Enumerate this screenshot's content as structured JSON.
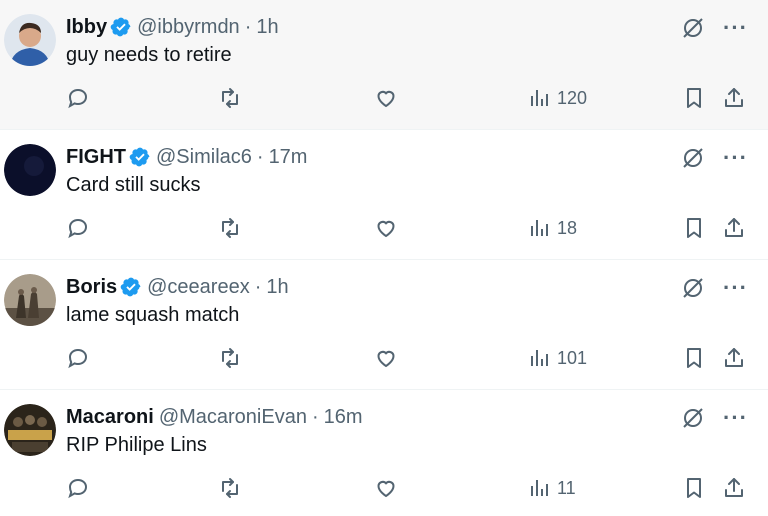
{
  "tweets": [
    {
      "name": "Ibby",
      "handle": "@ibbyrmdn",
      "time": "1h",
      "text": "guy needs to retire",
      "views": "120",
      "avatar_color": "#2f5fa8"
    },
    {
      "name": "FIGHT",
      "handle": "@Similac6",
      "time": "17m",
      "text": "Card still sucks",
      "views": "18",
      "avatar_color": "#0b0f2a"
    },
    {
      "name": "Boris",
      "handle": "@ceeareex",
      "time": "1h",
      "text": "lame squash match",
      "views": "101",
      "avatar_color": "#7a6a58"
    },
    {
      "name": "Macaroni",
      "handle": "@MacaroniEvan",
      "time": "16m",
      "text": "RIP Philipe Lins",
      "views": "11",
      "avatar_color": "#3a3224"
    }
  ],
  "separator": "·",
  "colors": {
    "verified": "#1d9bf0",
    "muted": "#536471",
    "text": "#0f1419"
  },
  "icons": [
    "reply-icon",
    "retweet-icon",
    "like-icon",
    "views-icon",
    "bookmark-icon",
    "share-icon",
    "grok-icon",
    "more-icon",
    "verified-badge-icon"
  ]
}
